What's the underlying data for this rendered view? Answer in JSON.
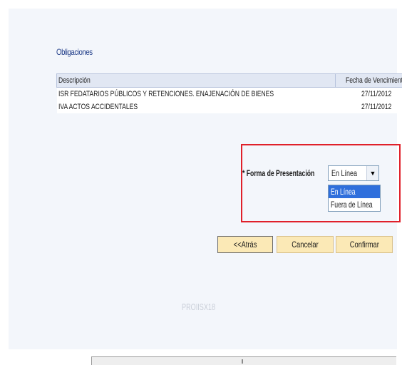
{
  "obligaciones": {
    "title": "Obligaciones",
    "columns": [
      "Descripción",
      "Fecha de Vencimiento"
    ],
    "rows": [
      {
        "descripcion": "ISR FEDATARIOS PÚBLICOS Y RETENCIONES. ENAJENACIÓN DE BIENES",
        "fecha": "27/11/2012"
      },
      {
        "descripcion": "IVA ACTOS ACCIDENTALES",
        "fecha": "27/11/2012"
      }
    ]
  },
  "forma": {
    "label": "* Forma de Presentación",
    "selected": "En Línea",
    "options": [
      "En Línea",
      "Fuera de Línea"
    ]
  },
  "buttons": {
    "atras": "<<Atrás",
    "cancelar": "Cancelar",
    "confirmar": "Confirmar"
  },
  "footer": {
    "code": "PROIISX18"
  },
  "colors": {
    "highlight_border": "#e0202a",
    "button_bg": "#fbe9b6",
    "option_selected": "#2f6fdc"
  }
}
